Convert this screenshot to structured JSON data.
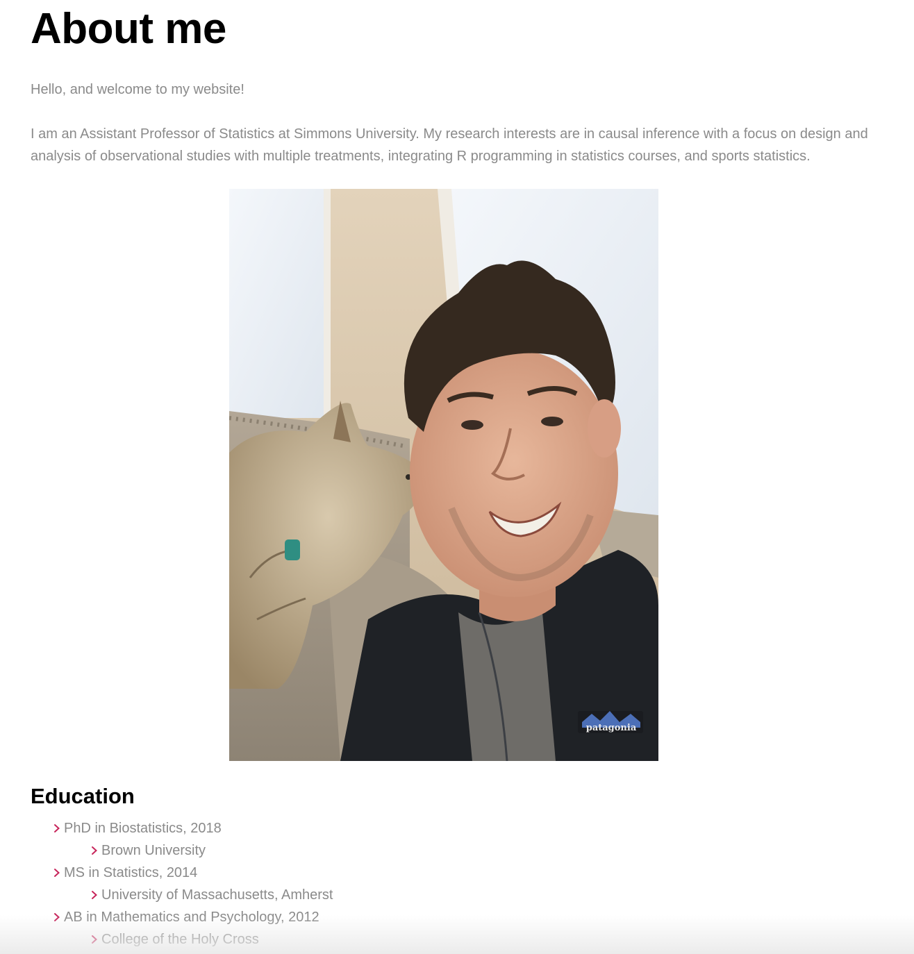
{
  "header": {
    "title": "About me"
  },
  "intro": {
    "greeting": "Hello, and welcome to my website!",
    "bio": "I am an Assistant Professor of Statistics at Simmons University. My research interests are in causal inference with a focus on design and analysis of observational studies with multiple treatments, integrating R programming in statistics courses, and sports statistics."
  },
  "photo": {
    "shirt_logo_text": "patagonia"
  },
  "education": {
    "heading": "Education",
    "items": [
      {
        "degree": "PhD in Biostatistics, 2018",
        "school": "Brown University"
      },
      {
        "degree": "MS in Statistics, 2014",
        "school": "University of Massachusetts, Amherst"
      },
      {
        "degree": "AB in Mathematics and Psychology, 2012",
        "school": "College of the Holy Cross"
      }
    ]
  },
  "colors": {
    "accent": "#c7245a",
    "body_text": "#8a8a8a",
    "heading_text": "#000000"
  },
  "icons": {
    "list_bullet": "chevron-right-icon"
  }
}
